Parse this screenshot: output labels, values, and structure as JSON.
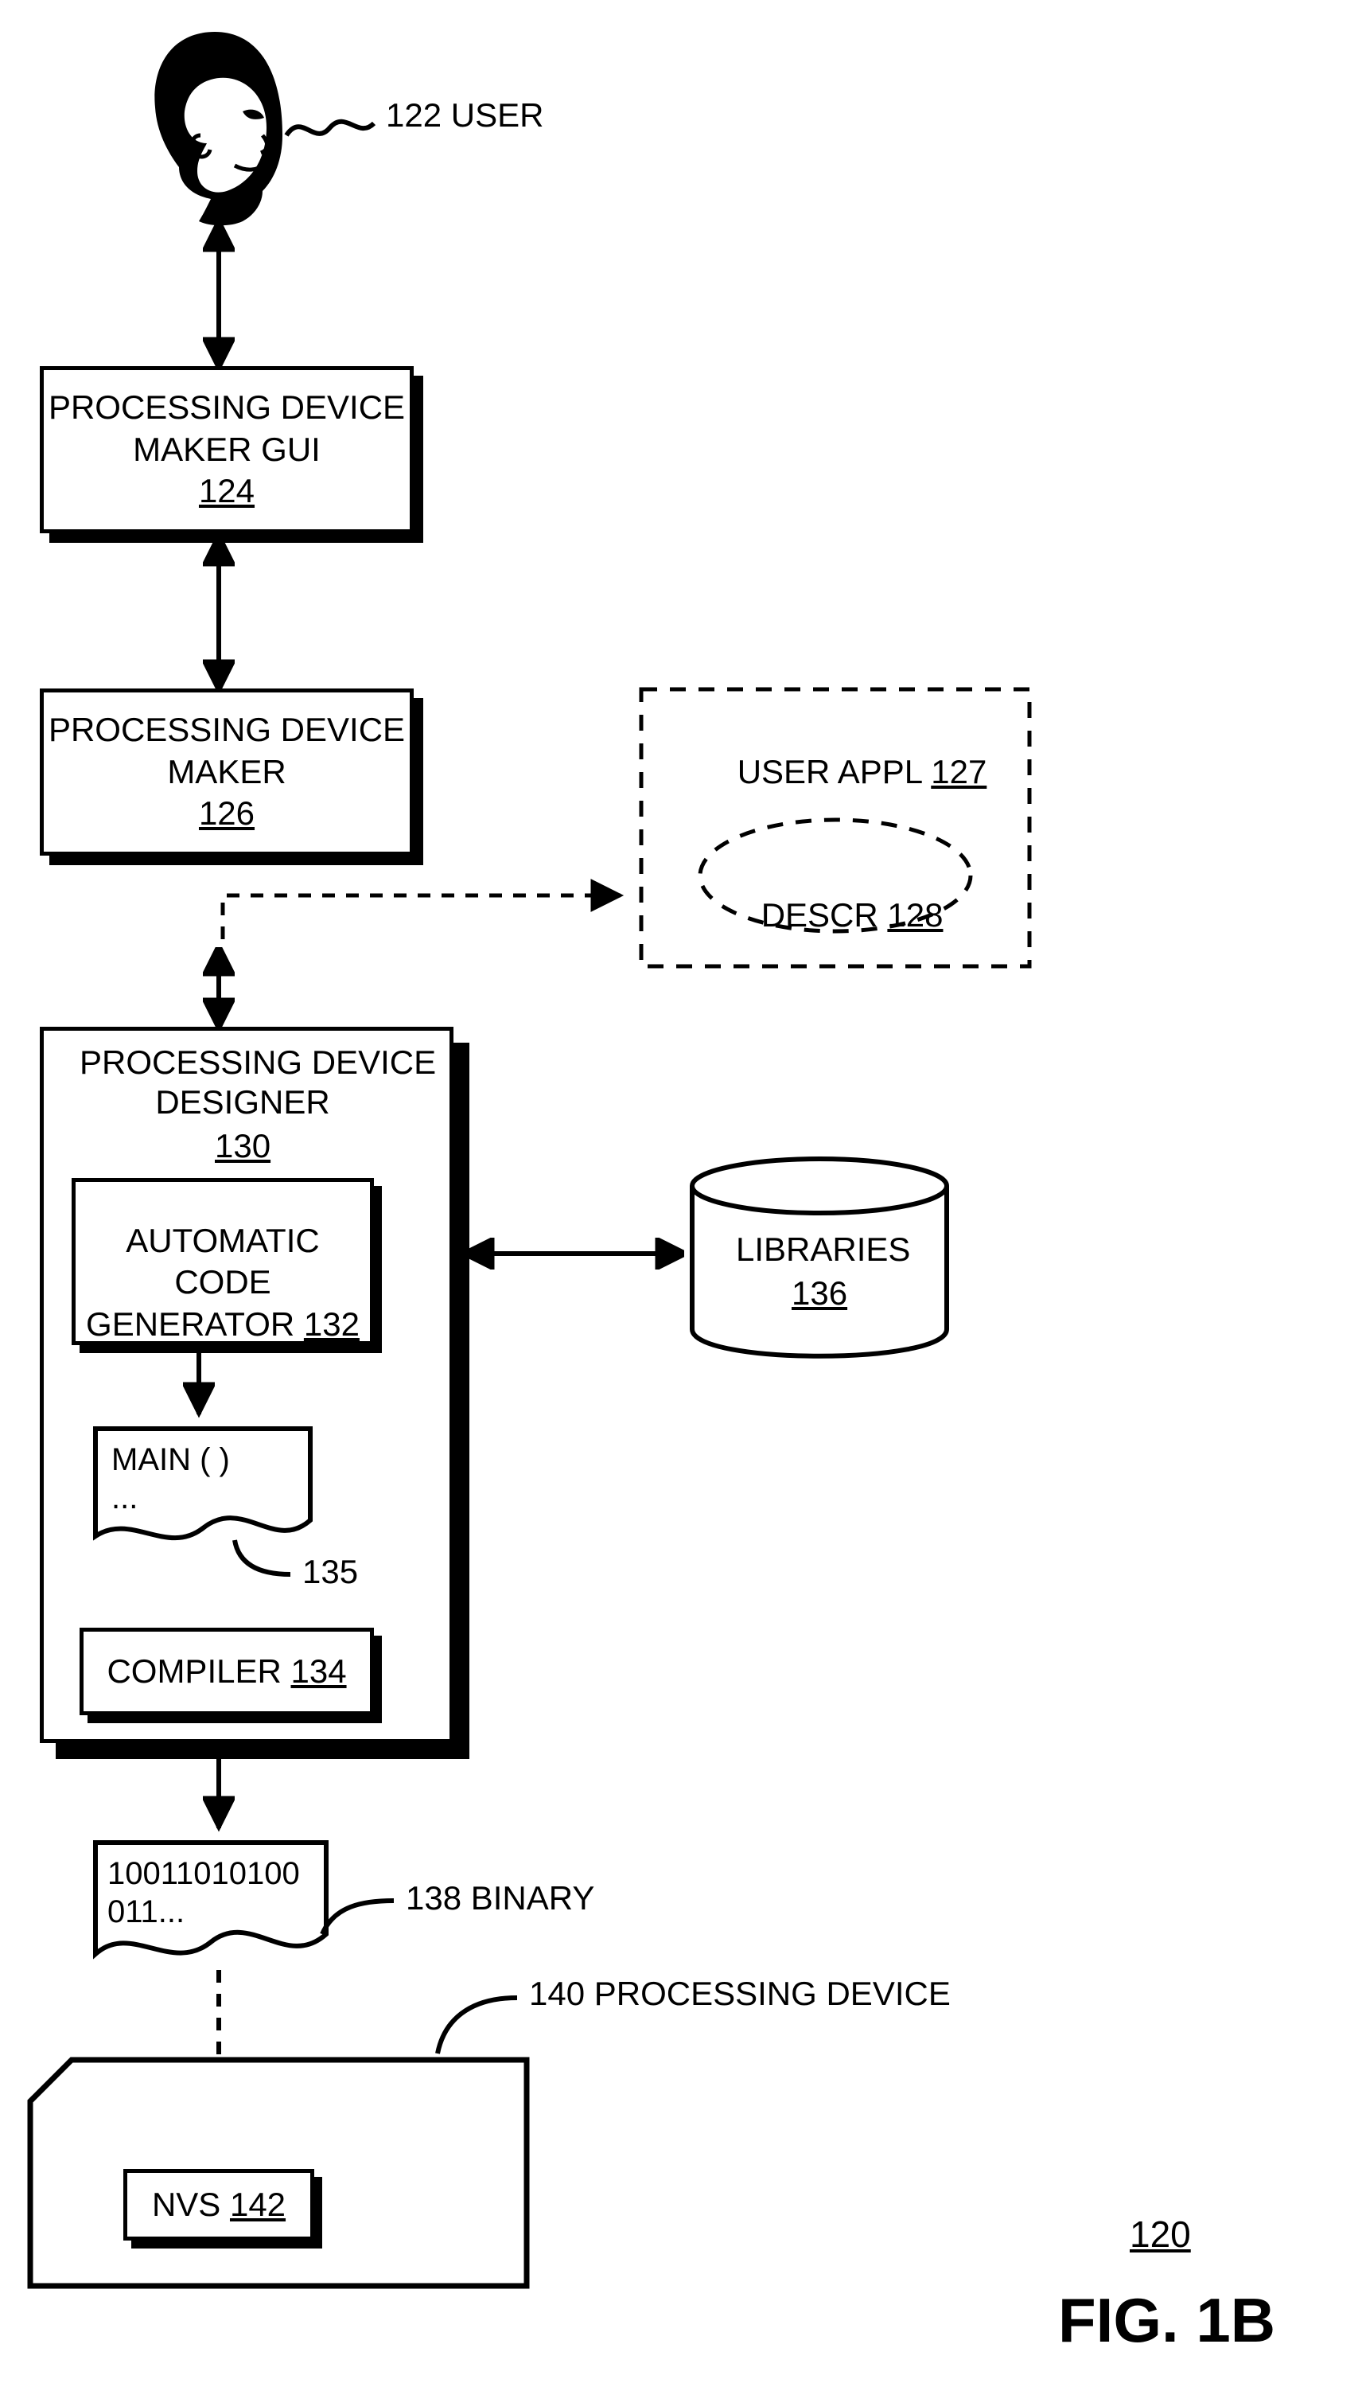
{
  "labels": {
    "user": "122 USER",
    "gui_title": "PROCESSING DEVICE\nMAKER GUI",
    "gui_num": "124",
    "maker_title": "PROCESSING DEVICE\nMAKER",
    "maker_num": "126",
    "userappl": "USER APPL ",
    "userappl_num": "127",
    "descr": "DESCR ",
    "descr_num": "128",
    "designer_title": "PROCESSING DEVICE\nDESIGNER",
    "designer_num": "130",
    "acg_title": "AUTOMATIC\nCODE\nGENERATOR ",
    "acg_num": "132",
    "main_text": "MAIN ( )\n...",
    "main_num": "135",
    "compiler": "COMPILER ",
    "compiler_num": "134",
    "libraries": "LIBRARIES",
    "libraries_num": "136",
    "binary_text": "10011010100\n011...",
    "binary_label": "138 BINARY",
    "device_label": "140 PROCESSING DEVICE",
    "nvs": "NVS ",
    "nvs_num": "142",
    "fig_num": "120",
    "fig_title": "FIG. 1B"
  }
}
